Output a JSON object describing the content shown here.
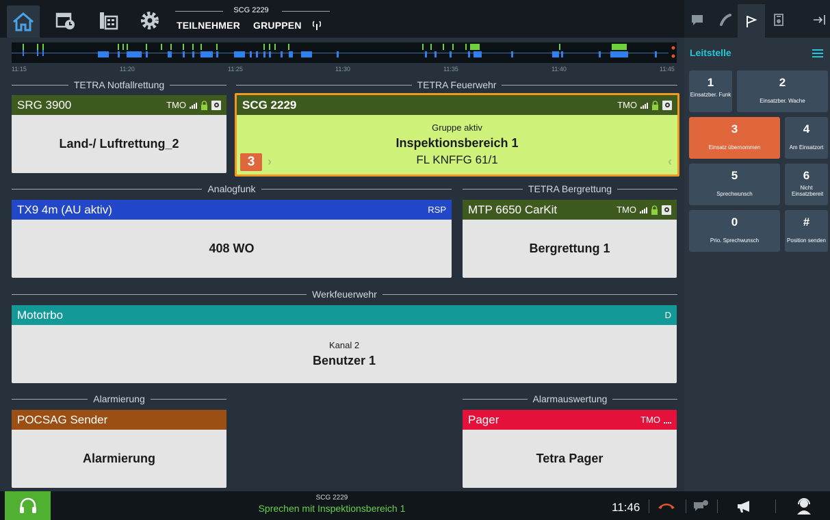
{
  "topbar": {
    "group_title": "SCG 2229",
    "tab_participants": "TEILNEHMER",
    "tab_groups": "GRUPPEN",
    "icons": [
      "home-icon",
      "calendar-clock-icon",
      "phonebook-icon",
      "gear-icon",
      "antenna-icon"
    ]
  },
  "timeline": {
    "times": [
      "11:15",
      "11:20",
      "11:25",
      "11:30",
      "11:35",
      "11:40",
      "11:45"
    ]
  },
  "sections": {
    "notfall": "TETRA Notfallrettung",
    "feuerwehr": "TETRA Feuerwehr",
    "analog": "Analogfunk",
    "berg": "TETRA Bergrettung",
    "werk": "Werkfeuerwehr",
    "alarmierung": "Alarmierung",
    "alarmauswertung": "Alarmauswertung"
  },
  "cards": {
    "srg": {
      "name": "SRG 3900",
      "mode": "TMO",
      "body": "Land-/ Luftrettung_2",
      "color": "#3e5a1f"
    },
    "scg": {
      "name": "SCG 2229",
      "mode": "TMO",
      "status": "Gruppe aktiv",
      "body": "Inspektionsbereich 1",
      "line3": "FL KNFFG 61/1",
      "badge": "3",
      "color": "#3e5a1f",
      "body_color": "#cff27a",
      "border_color": "#f29a1f"
    },
    "tx9": {
      "name": "TX9 4m (AU aktiv)",
      "mode": "RSP",
      "body": "408 WO",
      "color": "#2247c9"
    },
    "mtp": {
      "name": "MTP 6650 CarKit",
      "mode": "TMO",
      "body": "Bergrettung 1",
      "color": "#3e5a1f"
    },
    "mototrbo": {
      "name": "Mototrbo",
      "mode": "D",
      "status": "Kanal 2",
      "body": "Benutzer 1",
      "color": "#139a98"
    },
    "pocsag": {
      "name": "POCSAG Sender",
      "body": "Alarmierung",
      "color": "#9c4f14"
    },
    "pager": {
      "name": "Pager",
      "mode": "TMO",
      "body": "Tetra Pager",
      "color": "#e4123a"
    }
  },
  "right_panel": {
    "title": "Leitstelle",
    "icons": [
      "message-icon",
      "phone-icon",
      "flag-icon",
      "radio-icon",
      "logout-icon"
    ],
    "keys": [
      {
        "num": "1",
        "label": "Einsatzber. Funk"
      },
      {
        "num": "2",
        "label": "Einsatzber. Wache"
      },
      {
        "num": "3",
        "label": "Einsatz übernommen"
      },
      {
        "num": "4",
        "label": "Am Einsatzort"
      },
      {
        "num": "5",
        "label": "Sprechwunsch"
      },
      {
        "num": "6",
        "label": "Nicht Einsatzbereit"
      },
      {
        "num": "0",
        "label": "Prio. Sprechwunsch"
      },
      {
        "num": "#",
        "label": "Position senden"
      }
    ],
    "accent": "#26c6da",
    "active_key_color": "#e0673c"
  },
  "bottombar": {
    "group": "SCG 2229",
    "status": "Sprechen mit Inspektionsbereich 1",
    "time": "11:46"
  }
}
